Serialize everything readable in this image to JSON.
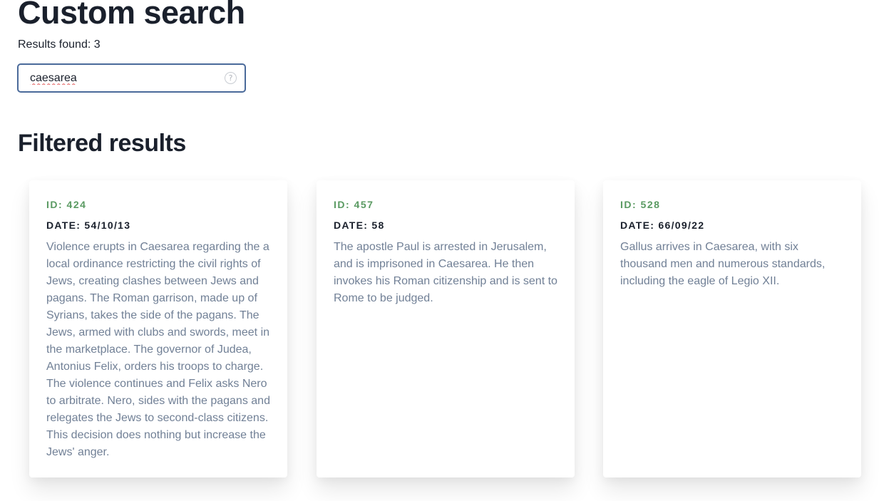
{
  "header": {
    "title": "Custom search",
    "results_label": "Results found: 3"
  },
  "search": {
    "value": "caesarea",
    "help_icon": "question-circle-icon"
  },
  "section": {
    "title": "Filtered results"
  },
  "colors": {
    "id_accent": "#5a9a62",
    "heading": "#1a202c",
    "body_text": "#718096",
    "focus_border": "#4a6a9a"
  },
  "cards": [
    {
      "id_label": "ID: 424",
      "date_label": "DATE: 54/10/13",
      "text": "Violence erupts in Caesarea regarding the a local ordinance restricting the civil rights of Jews, creating clashes between Jews and pagans. The Roman garrison, made up of Syrians, takes the side of the pagans. The Jews, armed with clubs and swords, meet in the marketplace. The governor of Judea, Antonius Felix, orders his troops to charge. The violence continues and Felix asks Nero to arbitrate. Nero, sides with the pagans and relegates the Jews to second-class citizens. This decision does nothing but increase the Jews' anger."
    },
    {
      "id_label": "ID: 457",
      "date_label": "DATE: 58",
      "text": "The apostle Paul is arrested in Jerusalem, and is imprisoned in Caesarea. He then invokes his Roman citizenship and is sent to Rome to be judged."
    },
    {
      "id_label": "ID: 528",
      "date_label": "DATE: 66/09/22",
      "text": "Gallus arrives in Caesarea, with six thousand men and numerous standards, including the eagle of Legio XII."
    }
  ]
}
